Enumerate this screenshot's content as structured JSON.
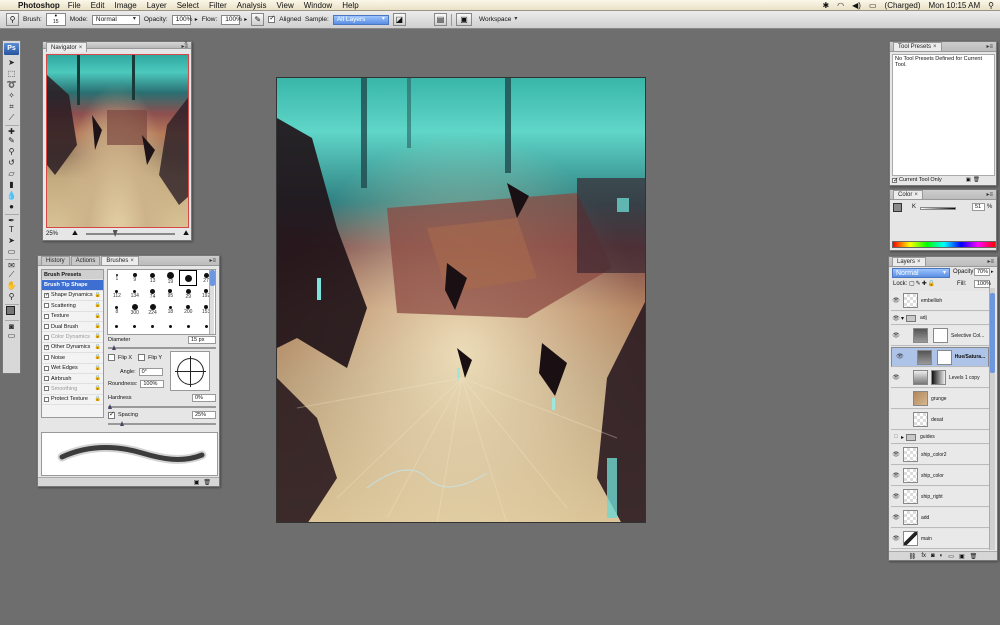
{
  "menubar": {
    "app": "Photoshop",
    "items": [
      "File",
      "Edit",
      "Image",
      "Layer",
      "Select",
      "Filter",
      "Analysis",
      "View",
      "Window",
      "Help"
    ],
    "battery": "(Charged)",
    "clock": "Mon 10:15 AM"
  },
  "options": {
    "brush_label": "Brush:",
    "brush_size": "15",
    "mode_label": "Mode:",
    "mode_value": "Normal",
    "opacity_label": "Opacity:",
    "opacity_value": "100%",
    "flow_label": "Flow:",
    "flow_value": "100%",
    "aligned_label": "Aligned",
    "sample_label": "Sample:",
    "sample_value": "All Layers",
    "workspace_label": "Workspace"
  },
  "navigator": {
    "tab": "Navigator",
    "zoom": "25%"
  },
  "brushes": {
    "tabs": [
      "History",
      "Actions",
      "Brushes"
    ],
    "list": [
      {
        "label": "Brush Presets",
        "type": "hdr"
      },
      {
        "label": "Brush Tip Shape",
        "type": "sel"
      },
      {
        "label": "Shape Dynamics",
        "checked": true
      },
      {
        "label": "Scattering",
        "checked": false
      },
      {
        "label": "Texture",
        "checked": false
      },
      {
        "label": "Dual Brush",
        "checked": false
      },
      {
        "label": "Color Dynamics",
        "checked": false,
        "dim": true
      },
      {
        "label": "Other Dynamics",
        "checked": true
      },
      {
        "label": "Noise",
        "checked": false
      },
      {
        "label": "Wet Edges",
        "checked": false
      },
      {
        "label": "Airbrush",
        "checked": false
      },
      {
        "label": "Smoothing",
        "checked": false,
        "dim": true
      },
      {
        "label": "Protect Texture",
        "checked": false
      }
    ],
    "tips": [
      "1",
      "9",
      "13",
      "19",
      "",
      "27",
      "112",
      "134",
      "74",
      "95",
      "29",
      "192",
      "8",
      "300",
      "224",
      "18",
      "200",
      "153",
      "",
      "",
      "",
      "",
      "",
      ""
    ],
    "diameter_label": "Diameter",
    "diameter_value": "15 px",
    "flipx": "Flip X",
    "flipy": "Flip Y",
    "angle_label": "Angle:",
    "angle_value": "0°",
    "roundness_label": "Roundness:",
    "roundness_value": "100%",
    "hardness_label": "Hardness",
    "hardness_value": "0%",
    "spacing_label": "Spacing",
    "spacing_value": "25%"
  },
  "toolpresets": {
    "tab": "Tool Presets",
    "message": "No Tool Presets Defined for Current Tool.",
    "current_only": "Current Tool Only"
  },
  "color": {
    "tab": "Color",
    "channel": "K",
    "value": "51",
    "unit": "%"
  },
  "layers": {
    "tab": "Layers",
    "blend": "Normal",
    "opacity_label": "Opacity:",
    "opacity_value": "70%",
    "lock_label": "Lock:",
    "fill_label": "Fill:",
    "fill_value": "100%",
    "rows": [
      "embellish",
      "adj",
      "Selective Col...",
      "Hue/Satura...",
      "Levels 1 copy",
      "grunge",
      "desat",
      "guides",
      "ship_color2",
      "ship_color",
      "ship_right",
      "add",
      "main"
    ]
  }
}
